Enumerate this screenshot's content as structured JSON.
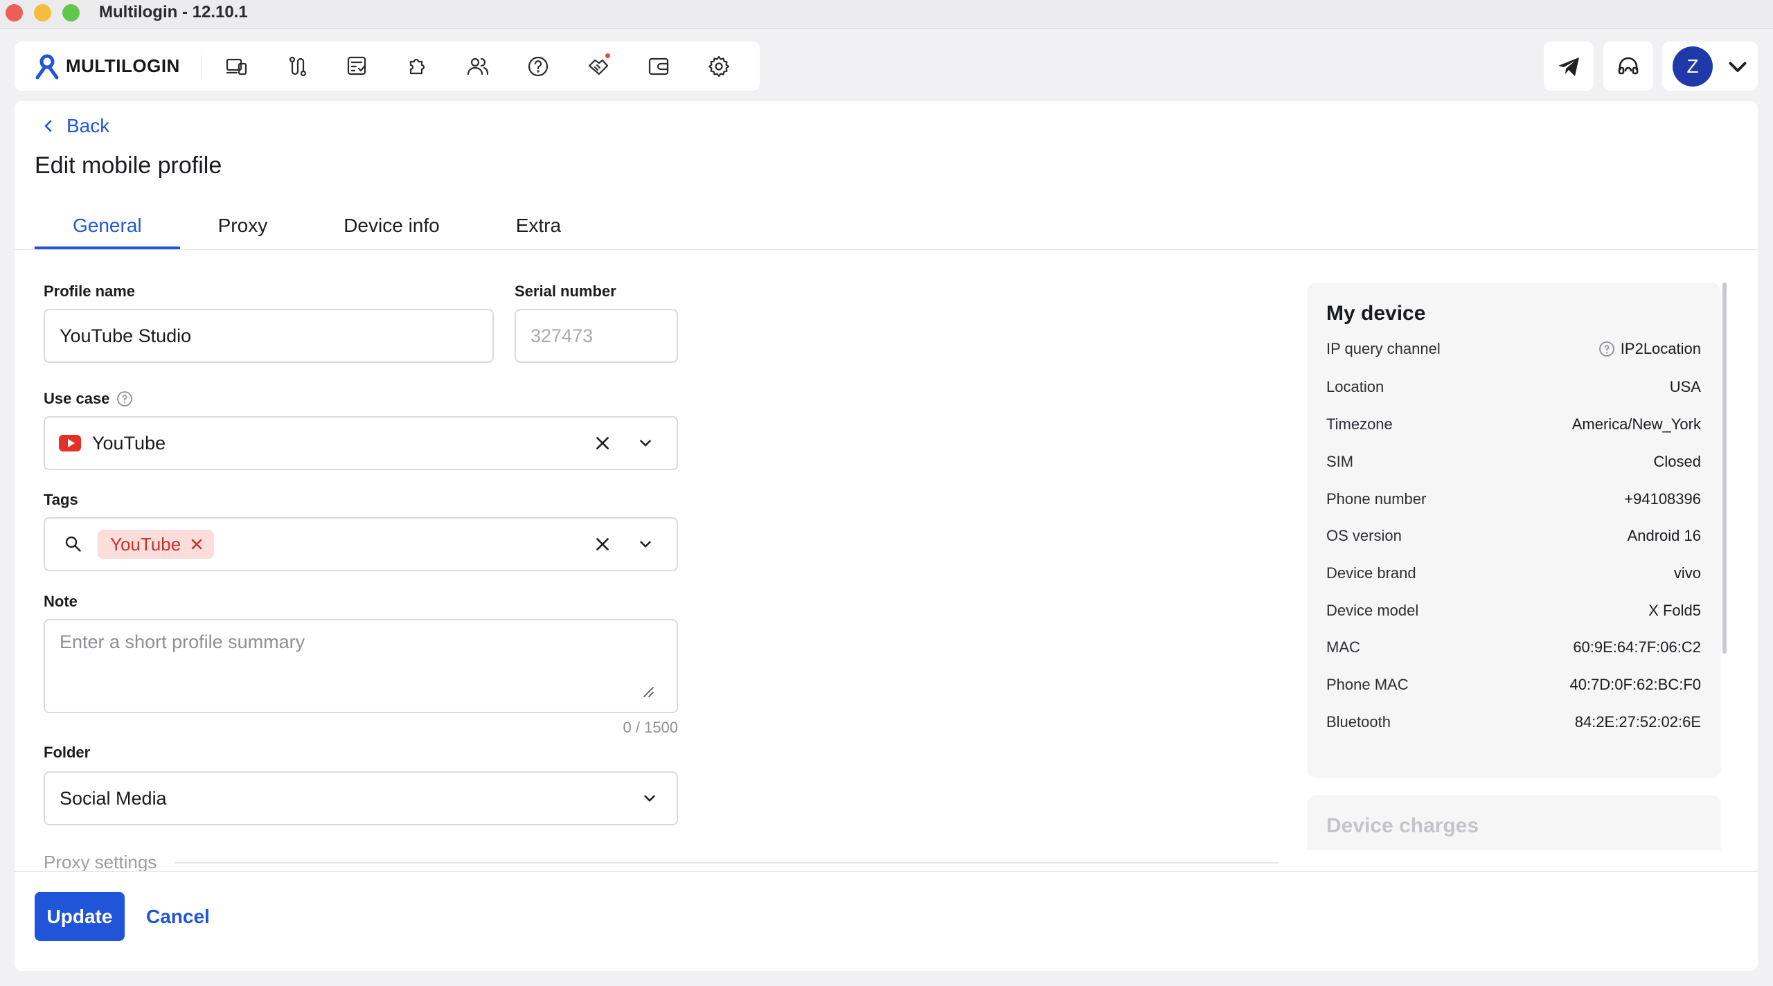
{
  "window": {
    "title": "Multilogin - 12.10.1"
  },
  "nav": {
    "logo_text": "MULTILOGIN",
    "icons": [
      "profiles-icon",
      "automation-icon",
      "scripts-icon",
      "extensions-icon",
      "team-icon",
      "help-icon",
      "partners-icon",
      "wallet-icon",
      "settings-icon"
    ],
    "user_initial": "Z"
  },
  "page": {
    "back_label": "Back",
    "title": "Edit mobile profile",
    "tabs": [
      {
        "label": "General",
        "active": true
      },
      {
        "label": "Proxy",
        "active": false
      },
      {
        "label": "Device info",
        "active": false
      },
      {
        "label": "Extra",
        "active": false
      }
    ]
  },
  "form": {
    "profile_name": {
      "label": "Profile name",
      "value": "YouTube Studio"
    },
    "serial_number": {
      "label": "Serial number",
      "placeholder": "327473"
    },
    "use_case": {
      "label": "Use case",
      "value": "YouTube"
    },
    "tags": {
      "label": "Tags",
      "chips": [
        "YouTube"
      ]
    },
    "note": {
      "label": "Note",
      "placeholder": "Enter a short profile summary",
      "counter": "0 / 1500"
    },
    "folder": {
      "label": "Folder",
      "value": "Social Media"
    },
    "proxy_section_title": "Proxy settings"
  },
  "device": {
    "title": "My device",
    "rows": [
      {
        "key": "IP query channel",
        "value": "IP2Location"
      },
      {
        "key": "Location",
        "value": "USA"
      },
      {
        "key": "Timezone",
        "value": "America/New_York"
      },
      {
        "key": "SIM",
        "value": "Closed"
      },
      {
        "key": "Phone number",
        "value": "+94108396"
      },
      {
        "key": "OS version",
        "value": "Android 16"
      },
      {
        "key": "Device brand",
        "value": "vivo"
      },
      {
        "key": "Device model",
        "value": "X Fold5"
      },
      {
        "key": "MAC",
        "value": "60:9E:64:7F:06:C2"
      },
      {
        "key": "Phone MAC",
        "value": "40:7D:0F:62:BC:F0"
      },
      {
        "key": "Bluetooth",
        "value": "84:2E:27:52:02:6E"
      }
    ],
    "charges_title": "Device charges"
  },
  "footer": {
    "update_label": "Update",
    "cancel_label": "Cancel"
  },
  "colors": {
    "accent": "#2055d9",
    "tag_bg": "#fbdedb",
    "tag_text": "#c8332b",
    "youtube_red": "#e33126"
  }
}
